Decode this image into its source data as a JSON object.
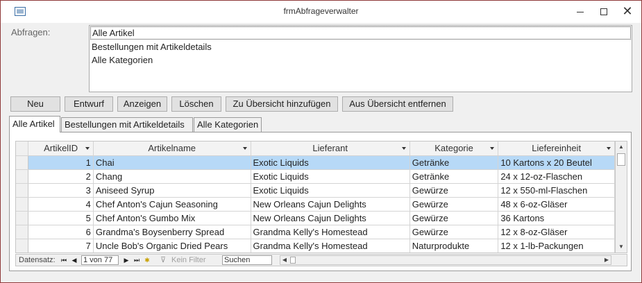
{
  "window": {
    "title": "frmAbfrageverwalter"
  },
  "queries": {
    "label": "Abfragen:",
    "items": [
      "Alle Artikel",
      "Bestellungen mit Artikeldetails",
      "Alle Kategorien"
    ],
    "selected_index": 0
  },
  "buttons": {
    "new": "Neu",
    "draft": "Entwurf",
    "show": "Anzeigen",
    "delete": "Löschen",
    "add_overview": "Zu Übersicht hinzufügen",
    "remove_overview": "Aus Übersicht entfernen"
  },
  "tabs": [
    "Alle Artikel",
    "Bestellungen mit Artikeldetails",
    "Alle Kategorien"
  ],
  "grid": {
    "columns": [
      "ArtikelID",
      "Artikelname",
      "Lieferant",
      "Kategorie",
      "Liefereinheit"
    ],
    "rows": [
      [
        "1",
        "Chai",
        "Exotic Liquids",
        "Getränke",
        "10 Kartons x 20 Beutel"
      ],
      [
        "2",
        "Chang",
        "Exotic Liquids",
        "Getränke",
        "24 x 12-oz-Flaschen"
      ],
      [
        "3",
        "Aniseed Syrup",
        "Exotic Liquids",
        "Gewürze",
        "12 x 550-ml-Flaschen"
      ],
      [
        "4",
        "Chef Anton's Cajun Seasoning",
        "New Orleans Cajun Delights",
        "Gewürze",
        "48 x 6-oz-Gläser"
      ],
      [
        "5",
        "Chef Anton's Gumbo Mix",
        "New Orleans Cajun Delights",
        "Gewürze",
        "36 Kartons"
      ],
      [
        "6",
        "Grandma's Boysenberry Spread",
        "Grandma Kelly's Homestead",
        "Gewürze",
        "12 x 8-oz-Gläser"
      ],
      [
        "7",
        "Uncle Bob's Organic Dried Pears",
        "Grandma Kelly's Homestead",
        "Naturprodukte",
        "12 x 1-lb-Packungen"
      ]
    ],
    "selected_row": 0
  },
  "navigation": {
    "label": "Datensatz:",
    "record": "1 von 77",
    "filter": "Kein Filter",
    "search": "Suchen"
  }
}
